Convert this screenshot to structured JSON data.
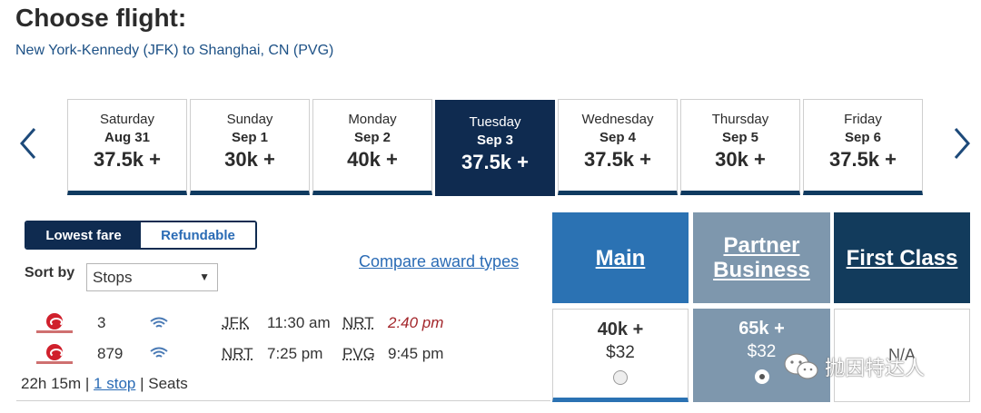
{
  "page": {
    "title": "Choose flight:",
    "route": "New York-Kennedy (JFK) to Shanghai, CN (PVG)"
  },
  "date_strip": {
    "dates": [
      {
        "day": "Saturday",
        "date": "Aug 31",
        "price": "37.5k +",
        "selected": false
      },
      {
        "day": "Sunday",
        "date": "Sep 1",
        "price": "30k +",
        "selected": false
      },
      {
        "day": "Monday",
        "date": "Sep 2",
        "price": "40k +",
        "selected": false
      },
      {
        "day": "Tuesday",
        "date": "Sep 3",
        "price": "37.5k +",
        "selected": true
      },
      {
        "day": "Wednesday",
        "date": "Sep 4",
        "price": "37.5k +",
        "selected": false
      },
      {
        "day": "Thursday",
        "date": "Sep 5",
        "price": "30k +",
        "selected": false
      },
      {
        "day": "Friday",
        "date": "Sep 6",
        "price": "37.5k +",
        "selected": false
      }
    ]
  },
  "filters": {
    "lowest_fare": "Lowest fare",
    "refundable": "Refundable",
    "sort_label": "Sort by",
    "sort_value": "Stops",
    "compare_link": "Compare award types"
  },
  "cabins": {
    "main": "Main",
    "partner_business": "Partner Business",
    "first_class": "First Class"
  },
  "flight": {
    "segments": [
      {
        "flight_number": "3",
        "from": "JFK",
        "depart": "11:30 am",
        "to": "NRT",
        "arrive": "2:40 pm"
      },
      {
        "flight_number": "879",
        "from": "NRT",
        "depart": "7:25 pm",
        "to": "PVG",
        "arrive": "9:45 pm"
      }
    ],
    "duration": "22h 15m",
    "stops": "1 stop",
    "seats": "Seats",
    "fares": {
      "main": {
        "miles": "40k +",
        "cash": "$32"
      },
      "partner_business": {
        "miles": "65k +",
        "cash": "$32"
      },
      "first_class": {
        "value": "N/A"
      }
    }
  },
  "watermark": {
    "text": "抛因特达人"
  },
  "colors": {
    "navy": "#0f2b50",
    "main_blue": "#2b72b3",
    "partner_gray": "#7e97ad",
    "first_dark": "#123b5c",
    "link_blue": "#2a6bb5",
    "late_red": "#a3262b"
  }
}
